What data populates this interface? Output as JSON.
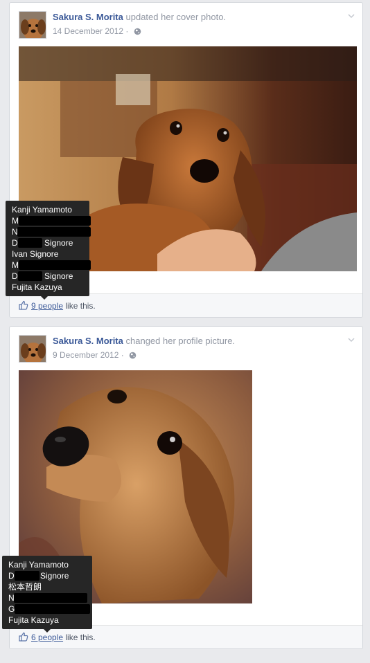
{
  "posts": [
    {
      "author": "Sakura S. Morita",
      "action": "updated her cover photo.",
      "date": "14 December 2012",
      "likes": {
        "count_text": "9 people",
        "suffix": "like this.",
        "tooltip": [
          "Kanji Yamamoto",
          "M",
          "N",
          "D",
          "Ivan Signore",
          "M",
          "D",
          "Fujita Kazuya"
        ],
        "tooltip_suffix": "Signore"
      }
    },
    {
      "author": "Sakura S. Morita",
      "action": "changed her profile picture.",
      "date": "9 December 2012",
      "likes": {
        "count_text": "6 people",
        "suffix": "like this.",
        "tooltip": [
          "Kanji Yamamoto",
          "D",
          "松本哲朗",
          "N",
          "G",
          "Fujita Kazuya"
        ],
        "tooltip_suffix": "Signore"
      }
    }
  ],
  "icons": {
    "privacy": "globe-icon",
    "options": "chevron-down-icon",
    "like": "thumbs-up-icon"
  },
  "colors": {
    "link": "#3b5998",
    "muted": "#9197a3",
    "background": "#e9eaed",
    "tooltip": "#262626"
  }
}
